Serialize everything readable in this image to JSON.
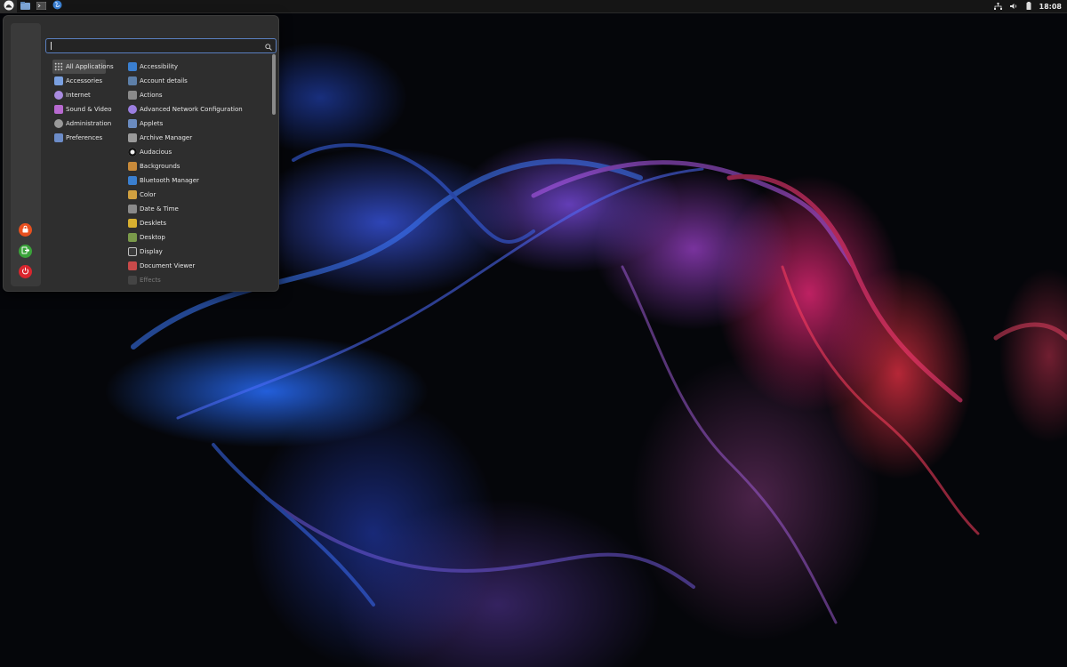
{
  "panel": {
    "launchers": [
      {
        "name": "files-launcher",
        "icon": "folder-icon"
      },
      {
        "name": "terminal-launcher",
        "icon": "terminal-icon"
      },
      {
        "name": "browser-launcher",
        "icon": "globe-icon"
      }
    ],
    "menu_icon": "cinnamon-menu-icon",
    "tray": [
      "network-icon",
      "volume-icon",
      "battery-icon"
    ],
    "clock": "18:08"
  },
  "menu": {
    "search": {
      "value": "",
      "placeholder": "",
      "icon": "search-icon"
    },
    "favorites": [
      {
        "name": "lock-screen-button",
        "icon": "lock-icon",
        "color": "#e8501f"
      },
      {
        "name": "logout-button",
        "icon": "logout-icon",
        "color": "#3aa33a"
      },
      {
        "name": "shutdown-button",
        "icon": "power-icon",
        "color": "#d9262e"
      }
    ],
    "categories": [
      {
        "label": "All Applications",
        "icon": "grid-icon",
        "color": "#cfcfcf",
        "selected": true
      },
      {
        "label": "Accessories",
        "icon": "accessories-icon",
        "color": "#7aa0e0"
      },
      {
        "label": "Internet",
        "icon": "internet-icon",
        "color": "#a98be0"
      },
      {
        "label": "Sound & Video",
        "icon": "media-icon",
        "color": "#b86ad0"
      },
      {
        "label": "Administration",
        "icon": "admin-icon",
        "color": "#9a9a9a"
      },
      {
        "label": "Preferences",
        "icon": "preferences-icon",
        "color": "#6c8cc8"
      }
    ],
    "apps": [
      {
        "label": "Accessibility",
        "icon": "accessibility-icon",
        "color": "#3a7fd0"
      },
      {
        "label": "Account details",
        "icon": "account-icon",
        "color": "#5d7fa8"
      },
      {
        "label": "Actions",
        "icon": "actions-icon",
        "color": "#8a8a8a"
      },
      {
        "label": "Advanced Network Configuration",
        "icon": "network-config-icon",
        "color": "#9b7ee0"
      },
      {
        "label": "Applets",
        "icon": "applets-icon",
        "color": "#6a8bc0"
      },
      {
        "label": "Archive Manager",
        "icon": "archive-icon",
        "color": "#9a9a9a"
      },
      {
        "label": "Audacious",
        "icon": "audacious-icon",
        "color": "#f0f0f0"
      },
      {
        "label": "Backgrounds",
        "icon": "backgrounds-icon",
        "color": "#c88a3a"
      },
      {
        "label": "Bluetooth Manager",
        "icon": "bluetooth-icon",
        "color": "#3a7fd0"
      },
      {
        "label": "Color",
        "icon": "color-icon",
        "color": "#d0a040"
      },
      {
        "label": "Date & Time",
        "icon": "date-time-icon",
        "color": "#8a8a8a"
      },
      {
        "label": "Desklets",
        "icon": "desklets-icon",
        "color": "#d8b030"
      },
      {
        "label": "Desktop",
        "icon": "desktop-icon",
        "color": "#7a9a4a"
      },
      {
        "label": "Display",
        "icon": "display-icon",
        "color": "#3a3a3a"
      },
      {
        "label": "Document Viewer",
        "icon": "document-viewer-icon",
        "color": "#c84a4a"
      },
      {
        "label": "Effects",
        "icon": "effects-icon",
        "color": "#5a5a5a",
        "faded": true
      }
    ]
  }
}
